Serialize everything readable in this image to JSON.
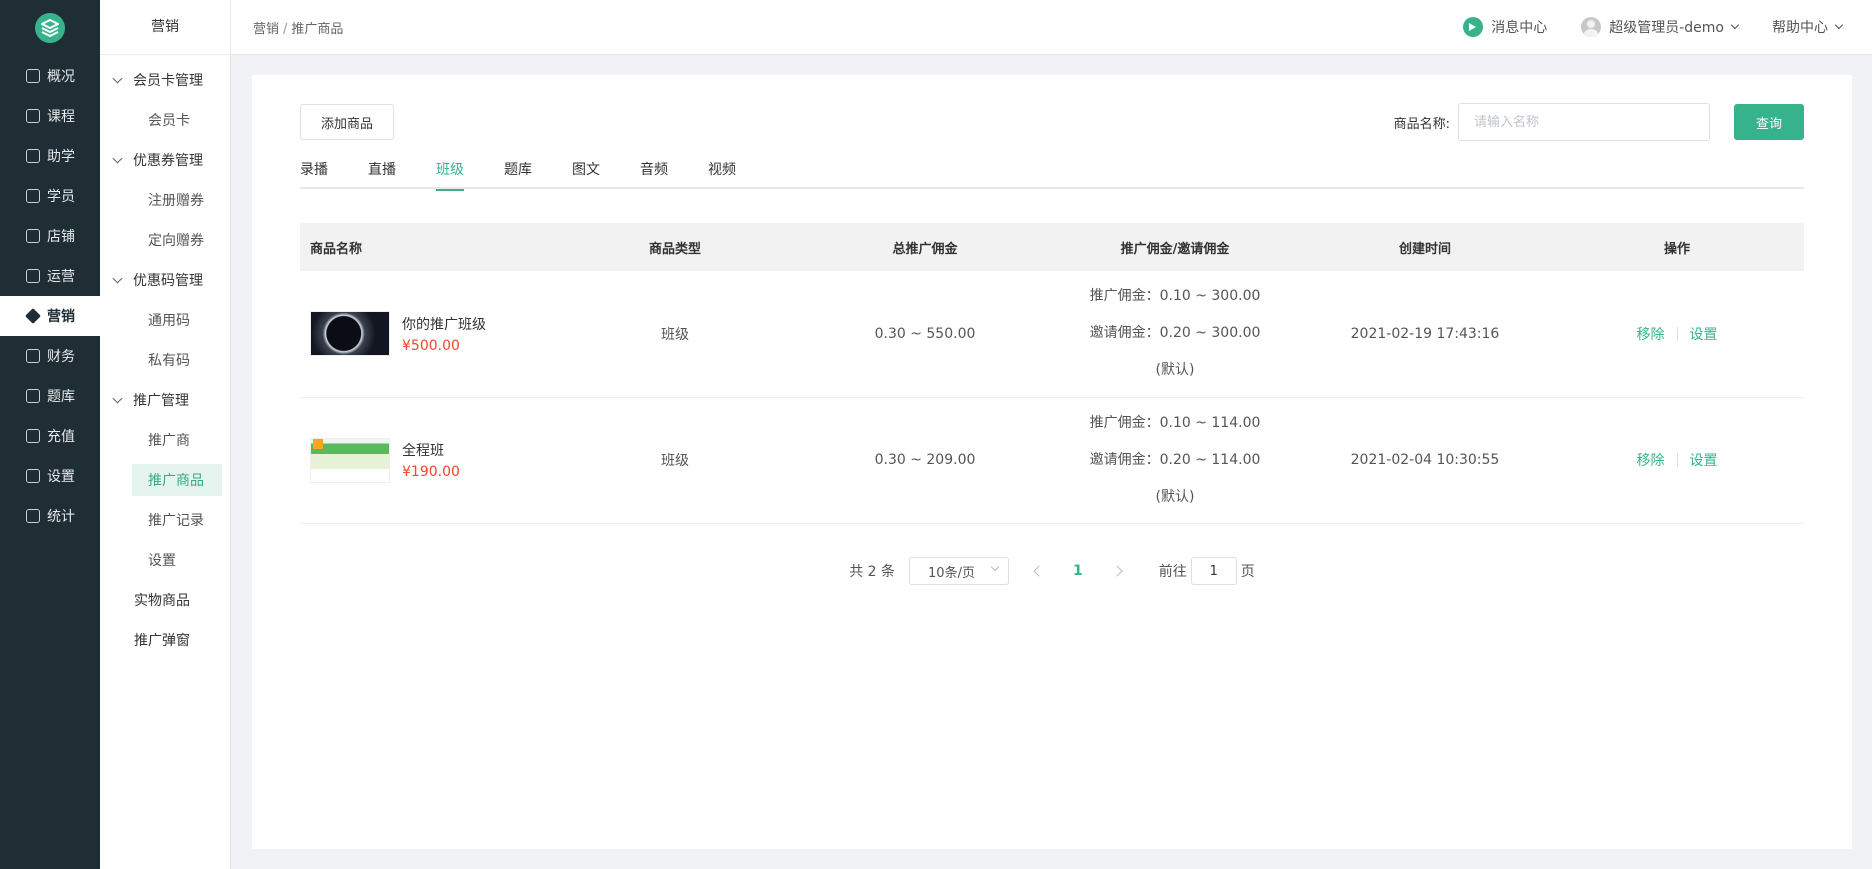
{
  "primary_nav": [
    {
      "label": "概况"
    },
    {
      "label": "课程"
    },
    {
      "label": "助学"
    },
    {
      "label": "学员"
    },
    {
      "label": "店铺"
    },
    {
      "label": "运营"
    },
    {
      "label": "营销"
    },
    {
      "label": "财务"
    },
    {
      "label": "题库"
    },
    {
      "label": "充值"
    },
    {
      "label": "设置"
    },
    {
      "label": "统计"
    }
  ],
  "secondary_nav": {
    "title": "营销",
    "groups": [
      {
        "label": "会员卡管理",
        "items": [
          "会员卡"
        ]
      },
      {
        "label": "优惠券管理",
        "items": [
          "注册赠券",
          "定向赠券"
        ]
      },
      {
        "label": "优惠码管理",
        "items": [
          "通用码",
          "私有码"
        ]
      },
      {
        "label": "推广管理",
        "items": [
          "推广商",
          "推广商品",
          "推广记录",
          "设置"
        ]
      }
    ],
    "plain_items": [
      "实物商品",
      "推广弹窗"
    ]
  },
  "topbar": {
    "breadcrumb": [
      "营销",
      "推广商品"
    ],
    "breadcrumb_sep": "/",
    "message_center": "消息中心",
    "user_name": "超级管理员-demo",
    "help_center": "帮助中心"
  },
  "toolbar": {
    "add_button": "添加商品",
    "search_label": "商品名称:",
    "search_placeholder": "请输入名称",
    "query_button": "查询"
  },
  "tabs": [
    "录播",
    "直播",
    "班级",
    "题库",
    "图文",
    "音频",
    "视频"
  ],
  "active_tab": "班级",
  "table": {
    "headers": [
      "商品名称",
      "商品类型",
      "总推广佣金",
      "推广佣金/邀请佣金",
      "创建时间",
      "操作"
    ],
    "rows": [
      {
        "name": "你的推广班级",
        "price": "¥500.00",
        "type": "班级",
        "total_commission": "0.30 ~ 550.00",
        "promo_commission": "推广佣金：0.10 ~ 300.00",
        "invite_commission": "邀请佣金：0.20 ~ 300.00",
        "default_note": "(默认)",
        "created": "2021-02-19 17:43:16",
        "op_remove": "移除",
        "op_settings": "设置"
      },
      {
        "name": "全程班",
        "price": "¥190.00",
        "type": "班级",
        "total_commission": "0.30 ~ 209.00",
        "promo_commission": "推广佣金：0.10 ~ 114.00",
        "invite_commission": "邀请佣金：0.20 ~ 114.00",
        "default_note": "(默认)",
        "created": "2021-02-04 10:30:55",
        "op_remove": "移除",
        "op_settings": "设置"
      }
    ]
  },
  "pagination": {
    "total": "共 2 条",
    "page_size": "10条/页",
    "current_page": "1",
    "goto_label": "前往",
    "goto_value": "1",
    "page_suffix": "页"
  },
  "colors": {
    "accent": "#37b38b",
    "price": "#f5452a",
    "nav_dark": "#1f2d35"
  }
}
